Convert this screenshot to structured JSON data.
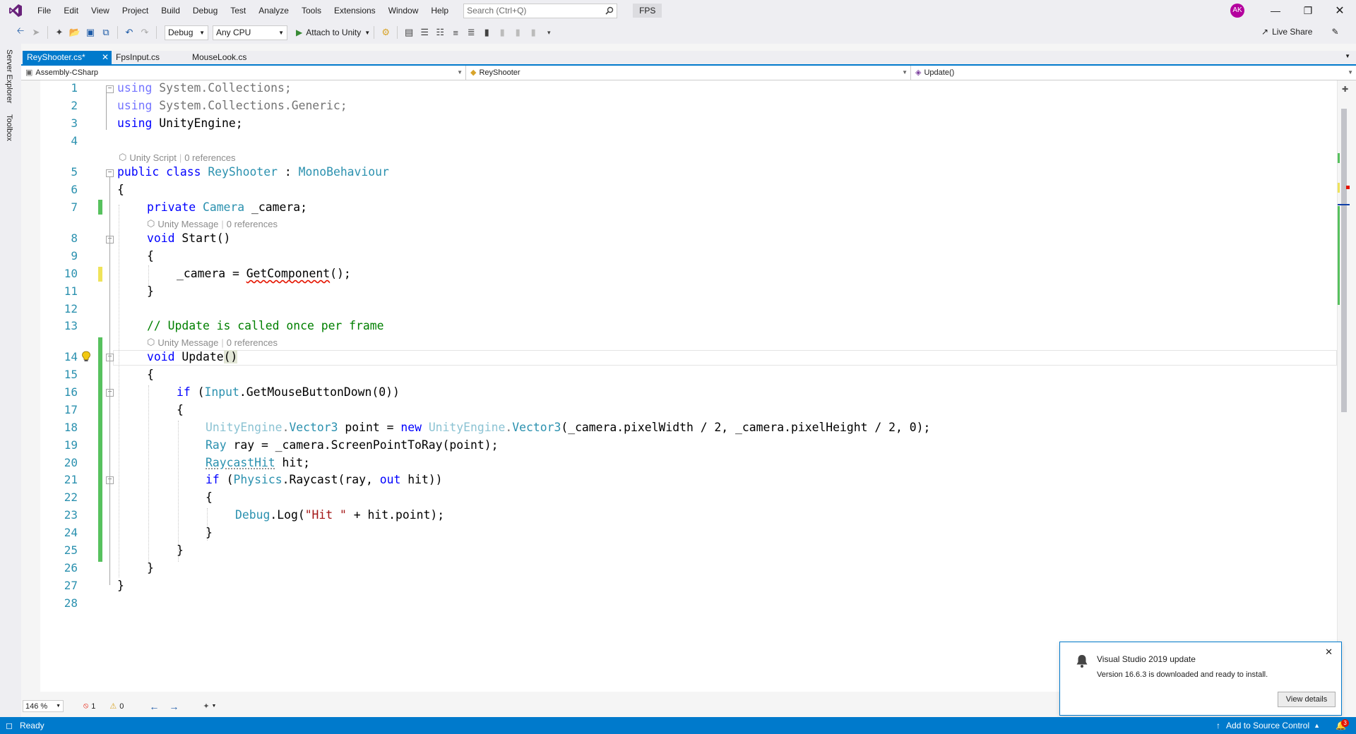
{
  "menu": {
    "items": [
      "File",
      "Edit",
      "View",
      "Project",
      "Build",
      "Debug",
      "Test",
      "Analyze",
      "Tools",
      "Extensions",
      "Window",
      "Help"
    ],
    "search_placeholder": "Search (Ctrl+Q)",
    "solution_name": "FPS",
    "user_initials": "AK"
  },
  "toolbar": {
    "configuration": "Debug",
    "platform": "Any CPU",
    "attach_label": "Attach to Unity",
    "live_share_label": "Live Share"
  },
  "side_rail": {
    "server_explorer": "Server Explorer",
    "toolbox": "Toolbox"
  },
  "tabs": [
    {
      "label": "ReyShooter.cs*",
      "active": true
    },
    {
      "label": "FpsInput.cs",
      "active": false
    },
    {
      "label": "MouseLook.cs",
      "active": false
    }
  ],
  "nav": {
    "project": "Assembly-CSharp",
    "class": "ReyShooter",
    "member": "Update()"
  },
  "code_lens": {
    "class": {
      "kind": "Unity Script",
      "refs": "0 references"
    },
    "start": {
      "kind": "Unity Message",
      "refs": "0 references"
    },
    "update": {
      "kind": "Unity Message",
      "refs": "0 references"
    }
  },
  "line_numbers": [
    "1",
    "2",
    "3",
    "4",
    "5",
    "6",
    "7",
    "8",
    "9",
    "10",
    "11",
    "12",
    "13",
    "14",
    "15",
    "16",
    "17",
    "18",
    "19",
    "20",
    "21",
    "22",
    "23",
    "24",
    "25",
    "26",
    "27",
    "28"
  ],
  "code": {
    "l1": [
      "using",
      " System.Collections;"
    ],
    "l2": [
      "using",
      " System.Collections.Generic;"
    ],
    "l3": [
      "using",
      " UnityEngine;"
    ],
    "l5": [
      "public",
      " ",
      "class",
      " ",
      "ReyShooter",
      " : ",
      "MonoBehaviour"
    ],
    "l6": "{",
    "l7": [
      "private",
      " ",
      "Camera",
      " _camera;"
    ],
    "l8": [
      "void",
      " Start()"
    ],
    "l9": "{",
    "l10": [
      "_camera = ",
      "GetComponent",
      "();"
    ],
    "l11": "}",
    "l13": "// Update is called once per frame",
    "l14": [
      "void",
      " Update",
      "()"
    ],
    "l15": "{",
    "l16": [
      "if",
      " (",
      "Input",
      ".GetMouseButtonDown(0))"
    ],
    "l17": "{",
    "l18": [
      "UnityEngine",
      ".",
      "Vector3",
      " point = ",
      "new",
      " ",
      "UnityEngine",
      ".",
      "Vector3",
      "(_camera.pixelWidth / 2, _camera.pixelHeight / 2, 0);"
    ],
    "l19": [
      "Ray",
      " ray = _camera.ScreenPointToRay(point);"
    ],
    "l20": [
      "RaycastHit",
      " hit;"
    ],
    "l21": [
      "if",
      " (",
      "Physics",
      ".Raycast(ray, ",
      "out",
      " hit))"
    ],
    "l22": "{",
    "l23": [
      "Debug",
      ".Log(",
      "\"Hit \"",
      " + hit.point);"
    ],
    "l24": "}",
    "l25": "}",
    "l26": "}",
    "l27": "}"
  },
  "editor_status": {
    "zoom": "146 %",
    "errors": "1",
    "warnings": "0"
  },
  "notification": {
    "title": "Visual Studio 2019 update",
    "message": "Version 16.6.3 is downloaded and ready to install.",
    "button": "View details"
  },
  "status": {
    "ready": "Ready",
    "source_control": "Add to Source Control",
    "notification_count": "3"
  },
  "colors": {
    "accent": "#007acc",
    "keyword": "#0000ff",
    "type": "#2b91af",
    "comment": "#008000",
    "string": "#a31515",
    "change_saved": "#57c15e",
    "change_unsaved": "#efe35a"
  }
}
